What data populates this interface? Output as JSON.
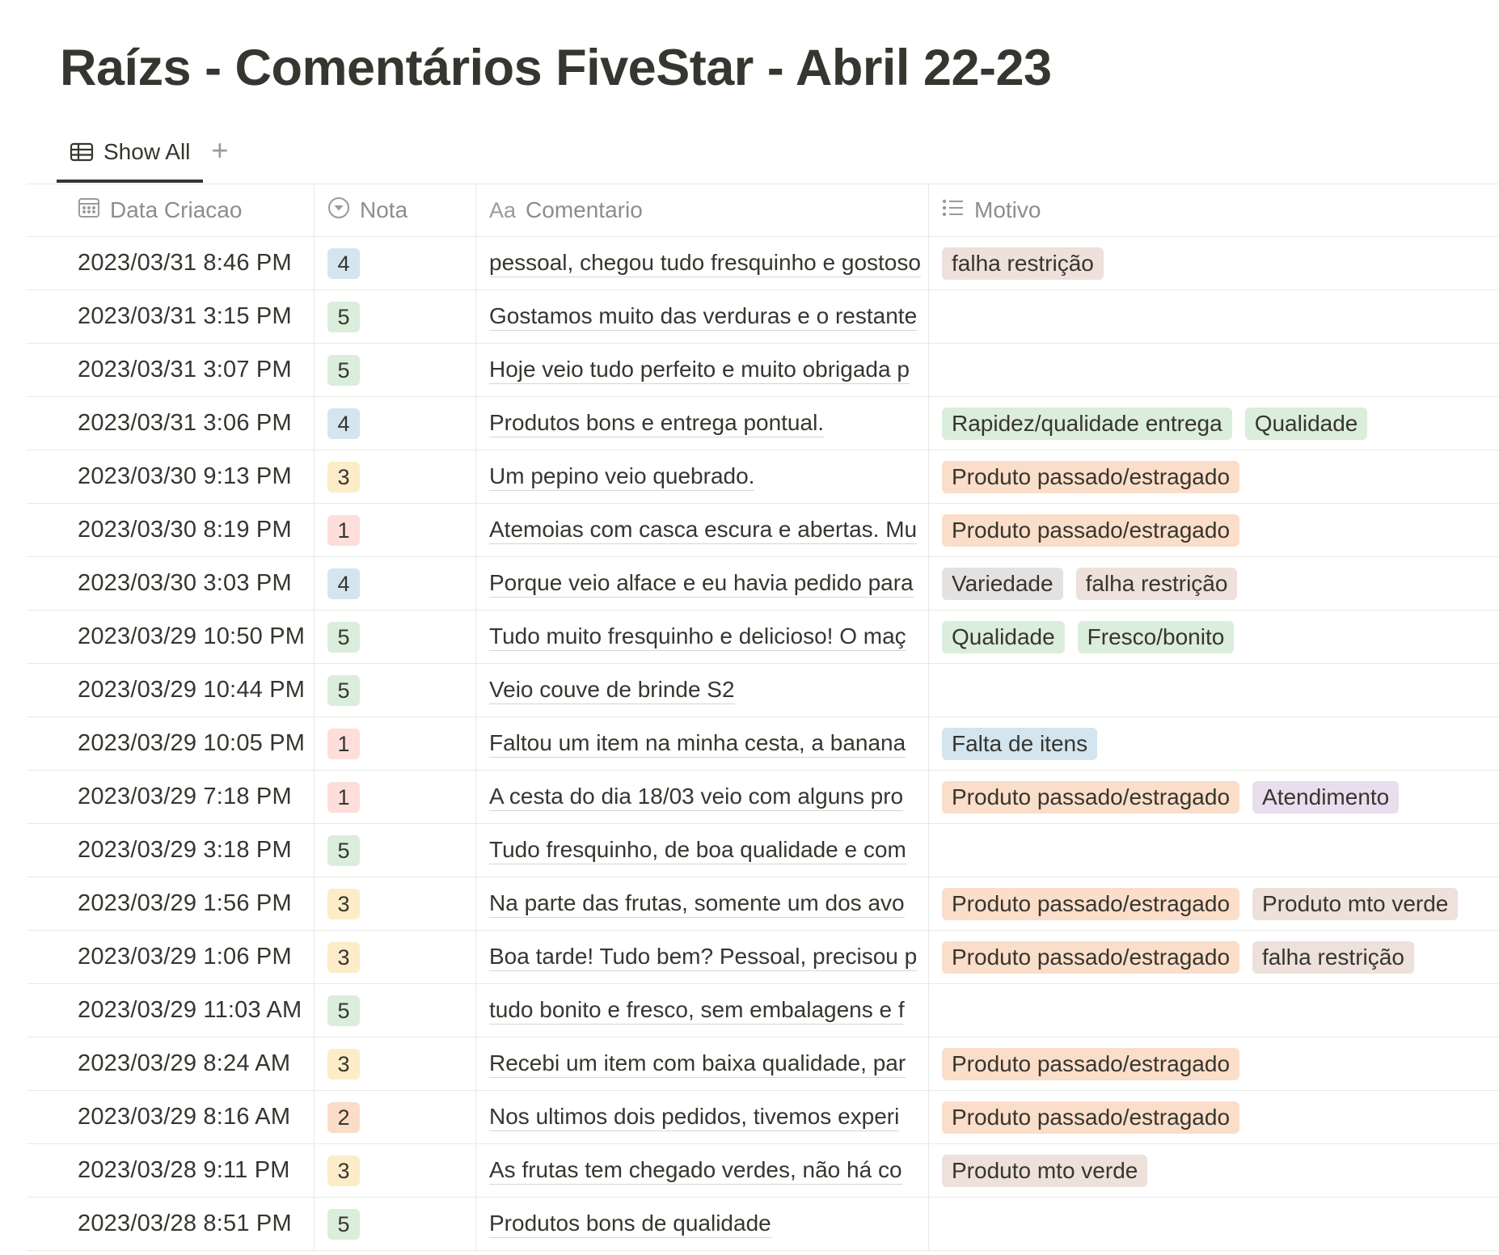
{
  "page": {
    "title": "Raízs - Comentários FiveStar - Abril 22-23"
  },
  "views": {
    "active_label": "Show All",
    "add_label": "+"
  },
  "columns": {
    "date": "Data Criacao",
    "nota": "Nota",
    "comentario": "Comentario",
    "motivo": "Motivo",
    "aa": "Aa"
  },
  "colors": {
    "nota": {
      "1": "#fddedb",
      "2": "#fbdcc8",
      "3": "#fdecc8",
      "4": "#d3e5ef",
      "5": "#dbeddb"
    },
    "tags": {
      "falha restrição": "#eee0da",
      "Rapidez/qualidade entrega": "#dbeddb",
      "Qualidade": "#dbeddb",
      "Produto passado/estragado": "#fadec9",
      "Variedade": "#e3e2e0",
      "Fresco/bonito": "#dbeddb",
      "Falta de itens": "#d3e5ef",
      "Atendimento": "#e8deee",
      "Produto mto verde": "#eee0da"
    }
  },
  "rows": [
    {
      "date": "2023/03/31 8:46 PM",
      "nota": "4",
      "comentario": "pessoal, chegou tudo fresquinho e gostoso",
      "motivo": [
        "falha restrição"
      ]
    },
    {
      "date": "2023/03/31 3:15 PM",
      "nota": "5",
      "comentario": "Gostamos muito das verduras e o restante",
      "motivo": []
    },
    {
      "date": "2023/03/31 3:07 PM",
      "nota": "5",
      "comentario": "Hoje veio tudo perfeito e muito obrigada p",
      "motivo": []
    },
    {
      "date": "2023/03/31 3:06 PM",
      "nota": "4",
      "comentario": "Produtos bons e entrega pontual.",
      "motivo": [
        "Rapidez/qualidade entrega",
        "Qualidade"
      ]
    },
    {
      "date": "2023/03/30 9:13 PM",
      "nota": "3",
      "comentario": "Um pepino veio quebrado.",
      "motivo": [
        "Produto passado/estragado"
      ]
    },
    {
      "date": "2023/03/30 8:19 PM",
      "nota": "1",
      "comentario": "Atemoias com casca escura e abertas. Mu",
      "motivo": [
        "Produto passado/estragado"
      ]
    },
    {
      "date": "2023/03/30 3:03 PM",
      "nota": "4",
      "comentario": "Porque veio alface e eu havia pedido para",
      "motivo": [
        "Variedade",
        "falha restrição"
      ]
    },
    {
      "date": "2023/03/29 10:50 PM",
      "nota": "5",
      "comentario": "Tudo muito fresquinho e delicioso! O maç",
      "motivo": [
        "Qualidade",
        "Fresco/bonito"
      ]
    },
    {
      "date": "2023/03/29 10:44 PM",
      "nota": "5",
      "comentario": "Veio couve de brinde S2",
      "motivo": []
    },
    {
      "date": "2023/03/29 10:05 PM",
      "nota": "1",
      "comentario": "Faltou um item na minha cesta, a banana",
      "motivo": [
        "Falta de itens"
      ]
    },
    {
      "date": "2023/03/29 7:18 PM",
      "nota": "1",
      "comentario": "A cesta do dia 18/03 veio com alguns pro",
      "motivo": [
        "Produto passado/estragado",
        "Atendimento"
      ]
    },
    {
      "date": "2023/03/29 3:18 PM",
      "nota": "5",
      "comentario": "Tudo fresquinho, de boa qualidade e com",
      "motivo": []
    },
    {
      "date": "2023/03/29 1:56 PM",
      "nota": "3",
      "comentario": "Na parte das frutas, somente um dos avo",
      "motivo": [
        "Produto passado/estragado",
        "Produto mto verde"
      ]
    },
    {
      "date": "2023/03/29 1:06 PM",
      "nota": "3",
      "comentario": "Boa tarde! Tudo bem? Pessoal, precisou p",
      "motivo": [
        "Produto passado/estragado",
        "falha restrição"
      ]
    },
    {
      "date": "2023/03/29 11:03 AM",
      "nota": "5",
      "comentario": "tudo bonito e fresco, sem embalagens e f",
      "motivo": []
    },
    {
      "date": "2023/03/29 8:24 AM",
      "nota": "3",
      "comentario": "Recebi um item com baixa qualidade, par",
      "motivo": [
        "Produto passado/estragado"
      ]
    },
    {
      "date": "2023/03/29 8:16 AM",
      "nota": "2",
      "comentario": "Nos ultimos dois pedidos, tivemos experi",
      "motivo": [
        "Produto passado/estragado"
      ]
    },
    {
      "date": "2023/03/28 9:11 PM",
      "nota": "3",
      "comentario": "As frutas tem chegado verdes, não há co",
      "motivo": [
        "Produto mto verde"
      ]
    },
    {
      "date": "2023/03/28 8:51 PM",
      "nota": "5",
      "comentario": "Produtos bons de qualidade",
      "motivo": []
    }
  ]
}
